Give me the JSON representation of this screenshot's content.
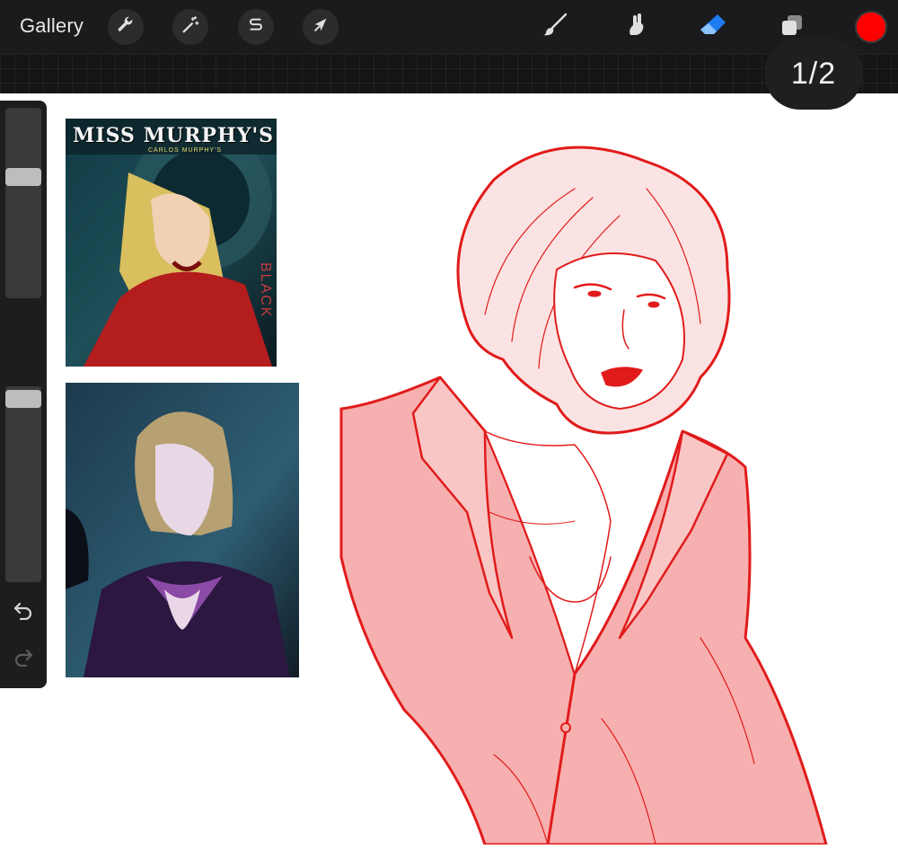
{
  "topbar": {
    "gallery_label": "Gallery",
    "left_tools": [
      {
        "name": "wrench-icon",
        "tip": "Actions"
      },
      {
        "name": "magic-wand-icon",
        "tip": "Adjustments"
      },
      {
        "name": "selection-s-icon",
        "tip": "Selection"
      },
      {
        "name": "arrow-cursor-icon",
        "tip": "Transform"
      }
    ],
    "right_tools": [
      {
        "name": "brush-icon"
      },
      {
        "name": "smudge-icon"
      },
      {
        "name": "eraser-icon"
      },
      {
        "name": "layers-icon"
      }
    ],
    "active_tool_color": "#1e7cf2",
    "current_color": "#ff0000"
  },
  "pager": {
    "label": "1/2"
  },
  "sidebar": {
    "brush_size_level": 0.35,
    "opacity_level": 0.02,
    "modify_icon": "square-icon",
    "undo_icon": "undo-icon",
    "redo_icon": "redo-icon"
  },
  "references": {
    "ref1": {
      "title": "MISS MURPHY'S",
      "subtitle": "CARLOS MURPHY'S",
      "side_text": "BLACK"
    },
    "ref2": {}
  },
  "colors": {
    "sketch_line": "#e11b1b",
    "sketch_fill": "#f7b0b0",
    "toolbar_bg": "#1b1b1d"
  }
}
